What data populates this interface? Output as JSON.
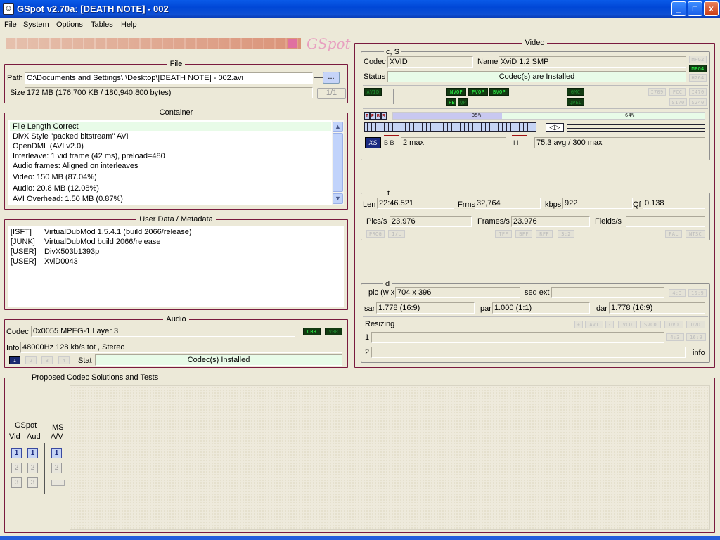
{
  "window": {
    "title": "GSpot v2.70a: [DEATH NOTE] - 002",
    "min": "_",
    "max": "□",
    "close": "x"
  },
  "menu": [
    "File",
    "System",
    "Options",
    "Tables",
    "Help"
  ],
  "logo": "GSpot",
  "file": {
    "title": "File",
    "path_label": "Path",
    "path_value": "C:\\Documents and Settings\\           \\Desktop\\[DEATH NOTE] - 002.avi",
    "browse_label": "...",
    "size_label": "Size",
    "size_value": "172 MB (176,700 KB / 180,940,800 bytes)",
    "page_label": "1/1"
  },
  "container": {
    "title": "Container",
    "items": [
      "File Length Correct",
      "DivX Style \"packed bitstream\" AVI",
      "OpenDML (AVI v2.0)",
      "Interleave: 1 vid frame (42 ms), preload=480",
      "Audio frames: Aligned on interleaves",
      "Video: 150 MB (87.04%)",
      "Audio: 20.8 MB (12.08%)",
      "AVI Overhead: 1.50 MB (0.87%)"
    ]
  },
  "userdata": {
    "title": "User Data / Metadata",
    "rows": [
      {
        "tag": "[ISFT]",
        "value": "VirtualDubMod 1.5.4.1 (build 2066/release)"
      },
      {
        "tag": "[JUNK]",
        "value": "VirtualDubMod build 2066/release"
      },
      {
        "tag": "[USER]",
        "value": "DivX503b1393p"
      },
      {
        "tag": "[USER]",
        "value": "XviD0043"
      }
    ]
  },
  "audio": {
    "title": "Audio",
    "codec_label": "Codec",
    "codec_value": "0x0055  MPEG-1 Layer 3",
    "cbr": "CBR",
    "vbr": "VBR",
    "info_label": "Info",
    "info_value": "48000Hz  128 kb/s tot , Stereo",
    "tabs": [
      "1",
      "2",
      "3",
      "4"
    ],
    "stat_label": "Stat",
    "stat_value": "Codec(s) Installed"
  },
  "video": {
    "title": "Video",
    "cs": {
      "title": "c, S",
      "codec_label": "Codec",
      "codec_value": "XVID",
      "name_label": "Name",
      "name_value": "XviD 1.2 SMP",
      "status_label": "Status",
      "status_value": "Codec(s) are Installed",
      "formats": [
        "MPG2",
        "MPG4",
        "H264"
      ]
    },
    "flags": {
      "avid": "AVID",
      "nvop": "NVOP",
      "pvop": "PVOP",
      "bvop": "BVOP",
      "pb": "PB",
      "qp": "QP",
      "gmc": "GMC",
      "qpel": "QPEL",
      "i709": "I709",
      "fcc": "FCC",
      "i470": "I470",
      "s170": "S170",
      "s240": "S240"
    },
    "frames": {
      "ipb": [
        "I",
        "P",
        "B",
        "S"
      ],
      "bar1_pct": 35,
      "bar1_label": "35%",
      "bar2_label": "64%",
      "b_label": "B B",
      "b_value": "2 max",
      "i_label": "I I",
      "i_value": "75.3 avg / 300 max"
    },
    "t": {
      "title": "t",
      "len_label": "Len",
      "len_value": "22:46.521",
      "frms_label": "Frms",
      "frms_value": "32,764",
      "kbps_label": "kbps",
      "kbps_value": "922",
      "qf_label": "Qf",
      "qf_value": "0.138",
      "pics_label": "Pics/s",
      "pics_value": "23.976",
      "framess_label": "Frames/s",
      "framess_value": "23.976",
      "fields_label": "Fields/s",
      "flags": [
        "PROG",
        "I/L",
        "TFF",
        "BFF",
        "RFF",
        "3:2",
        "PAL",
        "NTSC"
      ]
    },
    "d": {
      "title": "d",
      "pic_label": "pic (w x h)",
      "pic_value": "704 x 396",
      "seqext_label": "seq ext",
      "ar1": "4:3",
      "ar2": "16:9",
      "sar_label": "sar",
      "sar_value": "1.778 (16:9)",
      "par_label": "par",
      "par_value": "1.000 (1:1)",
      "dar_label": "dar",
      "dar_value": "1.778 (16:9)",
      "resizing_label": "Resizing",
      "resize_btns": [
        "+",
        "AVI",
        "-",
        "VCD",
        "SVCD",
        "DVD",
        "DVD"
      ],
      "row1": "1",
      "row2": "2",
      "info_link": "info"
    }
  },
  "proposed": {
    "title": "Proposed Codec Solutions and Tests",
    "gspot_label": "GSpot",
    "vid_label": "Vid",
    "aud_label": "Aud",
    "ms_label": "MS",
    "av_label": "A/V",
    "nums": [
      "1",
      "2",
      "3"
    ]
  }
}
